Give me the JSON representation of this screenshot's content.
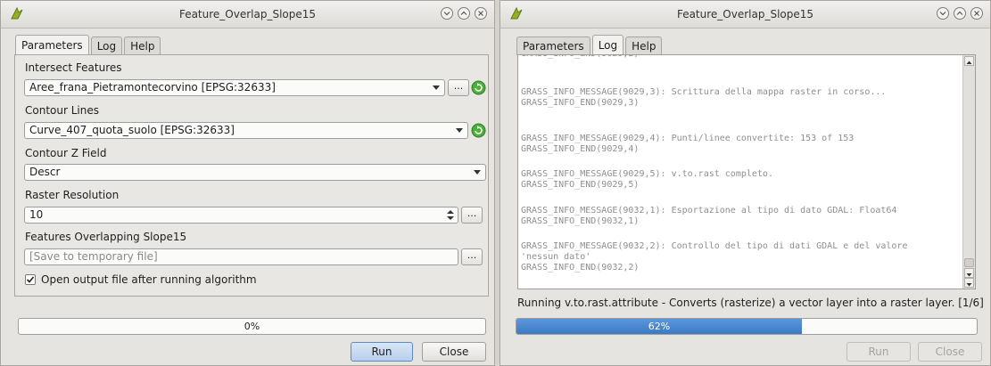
{
  "left": {
    "title": "Feature_Overlap_Slope15",
    "tabs": [
      "Parameters",
      "Log",
      "Help"
    ],
    "intersect_label": "Intersect Features",
    "intersect_value": "Aree_frana_Pietramontecorvino [EPSG:32633]",
    "contour_label": "Contour Lines",
    "contour_value": "Curve_407_quota_suolo [EPSG:32633]",
    "zfield_label": "Contour Z Field",
    "zfield_value": "Descr",
    "resolution_label": "Raster Resolution",
    "resolution_value": "10",
    "output_label": "Features Overlapping Slope15",
    "output_placeholder": "[Save to temporary file]",
    "browse_label": "...",
    "open_output_label": "Open output file after running algorithm",
    "open_output_checked": true,
    "progress": 0,
    "progress_text": "0%",
    "run_label": "Run",
    "close_label": "Close"
  },
  "right": {
    "title": "Feature_Overlap_Slope15",
    "tabs": [
      "Parameters",
      "Log",
      "Help"
    ],
    "log_lines": [
      "GRASS_INFO_MESSAGE(9029,3): Scrittura della mappa raster in corso...",
      "GRASS_INFO_END(9029,3)",
      "GRASS_INFO_MESSAGE(9029,4): Punti/linee convertite: 153 of 153",
      "GRASS_INFO_END(9029,4)",
      "GRASS_INFO_MESSAGE(9029,5): v.to.rast completo.",
      "GRASS_INFO_END(9029,5)",
      "GRASS_INFO_MESSAGE(9032,1): Esportazione al tipo di dato GDAL: Float64",
      "GRASS_INFO_END(9032,1)",
      "GRASS_INFO_MESSAGE(9032,2): Controllo del tipo di dati GDAL e del valore",
      "'nessun dato'",
      "GRASS_INFO_END(9032,2)"
    ],
    "status": "Running v.to.rast.attribute - Converts (rasterize) a vector layer into a raster layer. [1/6]",
    "progress": 0.62,
    "progress_text": "62%",
    "run_label": "Run",
    "close_label": "Close"
  },
  "colors": {
    "progress_fill": "#3d7ac4",
    "refresh_icon": "#4caf3a"
  }
}
